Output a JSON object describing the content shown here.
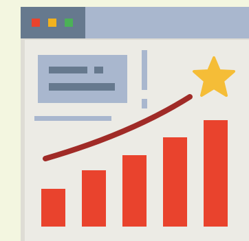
{
  "illustration": {
    "subject": "browser-window-growth-chart",
    "colors": {
      "background": "#f3f6e0",
      "window_frame": "#dedcd5",
      "window_body": "#ecebe5",
      "titlebar": "#a9b7ce",
      "titlebar_dark": "#66798e",
      "dot_red": "#e9432d",
      "dot_yellow": "#f3b21d",
      "dot_green": "#4bb157",
      "card": "#a9b7ce",
      "card_text": "#66798e",
      "accent_bar": "#a9b7ce",
      "bars": "#e9432d",
      "trend_line": "#a02b27",
      "star": "#f5bd37"
    },
    "bar_levels": [
      0.34,
      0.5,
      0.64,
      0.8,
      0.95
    ],
    "icons": [
      "window-dots-icon",
      "star-icon",
      "trend-line-icon"
    ]
  }
}
